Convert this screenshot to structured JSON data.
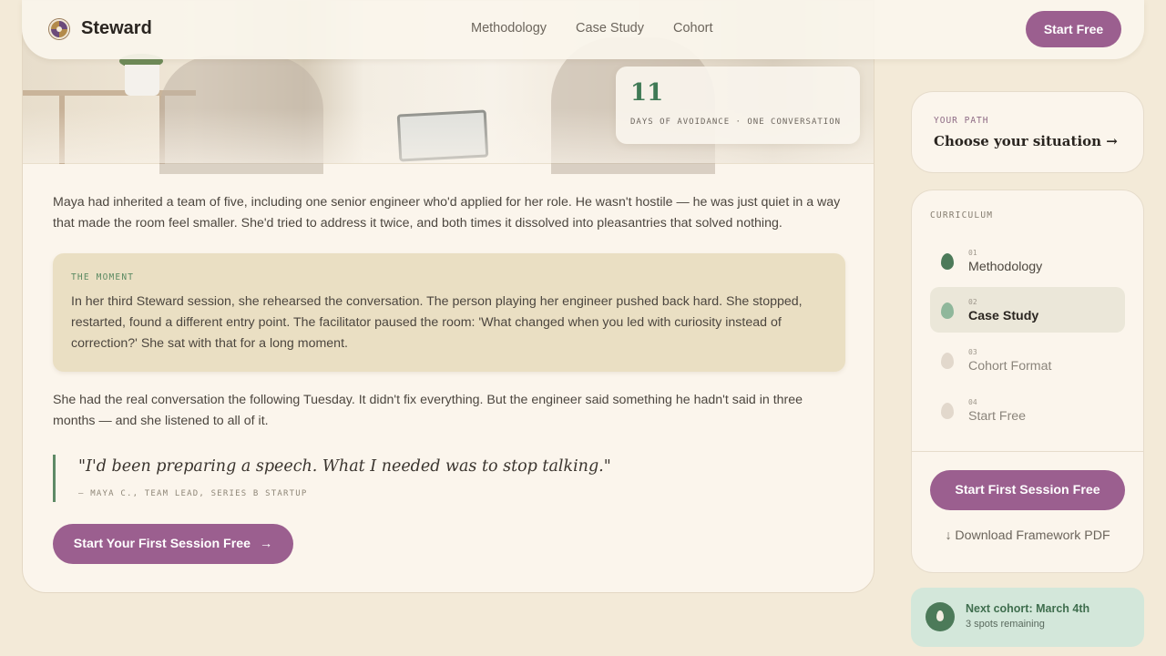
{
  "nav": {
    "brand": "Steward",
    "links": [
      "Methodology",
      "Case Study",
      "Cohort"
    ],
    "cta_label": "Start Free"
  },
  "hero": {
    "stat_number": "11",
    "stat_label": "DAYS OF AVOIDANCE · ONE CONVERSATION"
  },
  "story": {
    "p1": "Maya had inherited a team of five, including one senior engineer who'd applied for her role. He wasn't hostile — he was just quiet in a way that made the room feel smaller. She'd tried to address it twice, and both times it dissolved into pleasantries that solved nothing.",
    "moment_label": "THE MOMENT",
    "moment_text": "In her third Steward session, she rehearsed the conversation. The person playing her engineer pushed back hard. She stopped, restarted, found a different entry point. The facilitator paused the room: 'What changed when you led with curiosity instead of correction?' She sat with that for a long moment.",
    "p2": "She had the real conversation the following Tuesday. It didn't fix everything. But the engineer said something he hadn't said in three months — and she listened to all of it.",
    "quote": "\"I'd been preparing a speech. What I needed was to stop talking.\"",
    "quote_cite": "— MAYA C., TEAM LEAD, SERIES B STARTUP",
    "cta_label": "Start Your First Session Free",
    "cta_arrow": "→"
  },
  "sidebar": {
    "path_label": "YOUR PATH",
    "path_title": "Choose your situation →",
    "curriculum_label": "CURRICULUM",
    "items": [
      {
        "num": "01",
        "name": "Methodology",
        "state": "done",
        "leaf_color": "#4c7a59"
      },
      {
        "num": "02",
        "name": "Case Study",
        "state": "active",
        "leaf_color": "#8fb79b"
      },
      {
        "num": "03",
        "name": "Cohort Format",
        "state": "upcoming",
        "leaf_color": "#e2d8cc"
      },
      {
        "num": "04",
        "name": "Start Free",
        "state": "upcoming",
        "leaf_color": "#e2d8cc"
      }
    ],
    "cta_label": "Start First Session Free",
    "download_label": "↓ Download Framework PDF"
  },
  "cohort": {
    "title": "Next cohort: March 4th",
    "subtitle": "3 spots remaining"
  },
  "colors": {
    "accent": "#9b5f8f",
    "green": "#3f7a55",
    "background": "#f3ead8"
  }
}
